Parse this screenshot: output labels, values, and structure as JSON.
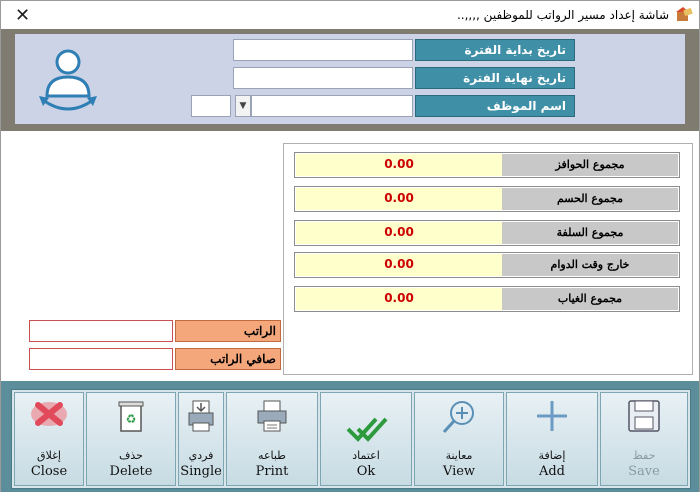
{
  "window": {
    "title": "شاشة إعداد مسير الرواتب للموظفين ,,,,..",
    "close_glyph": "✕"
  },
  "header": {
    "start_date_label": "تاريخ بداية الفترة",
    "end_date_label": "تاريخ نهاية الفترة",
    "employee_label": "اسم الموظف",
    "start_date_value": "",
    "end_date_value": "",
    "employee_value": "",
    "employee_code": ""
  },
  "totals": [
    {
      "label": "مجموع الحوافز",
      "value": "0.00"
    },
    {
      "label": "مجموع الحسم",
      "value": "0.00"
    },
    {
      "label": "مجموع السلفة",
      "value": "0.00"
    },
    {
      "label": "خارج وقت الدوام",
      "value": "0.00"
    },
    {
      "label": "مجموع الغياب",
      "value": "0.00"
    }
  ],
  "salary": {
    "salary_label": "الراتب",
    "net_salary_label": "صافي الراتب",
    "salary_value": "",
    "net_salary_value": ""
  },
  "toolbar": {
    "close": {
      "ar": "إغلاق",
      "en": "Close"
    },
    "delete": {
      "ar": "حذف",
      "en": "Delete"
    },
    "single": {
      "ar": "فردي",
      "en": "Single"
    },
    "print": {
      "ar": "طباعه",
      "en": "Print"
    },
    "ok": {
      "ar": "اعتماد",
      "en": "Ok"
    },
    "view": {
      "ar": "معاينة",
      "en": "View"
    },
    "add": {
      "ar": "إضافة",
      "en": "Add"
    },
    "save": {
      "ar": "حفظ",
      "en": "Save"
    }
  },
  "colors": {
    "header_label": "#3f8fa7",
    "total_value": "#cc0000",
    "salary_label": "#f5a77c",
    "toolbar": "#5b8e9a"
  },
  "icons": [
    "app-icon",
    "user-avatar-icon",
    "close-x-icon",
    "recycle-bin-icon",
    "single-print-icon",
    "printer-icon",
    "check-icon",
    "magnifier-plus-icon",
    "plus-icon",
    "floppy-disk-icon"
  ]
}
